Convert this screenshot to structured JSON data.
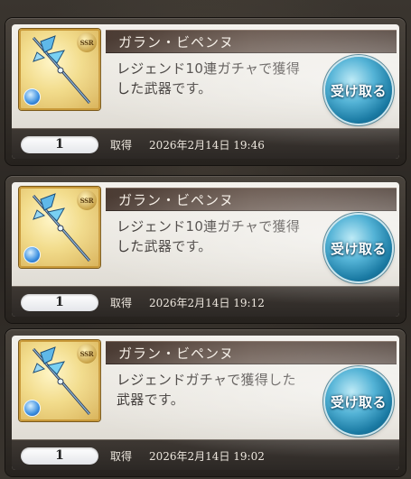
{
  "cards": [
    {
      "title": "ガラン・ビペンヌ",
      "rarity": "SSR",
      "description": "レジェンド10連ガチャで獲得した武器です。",
      "button_label": "受け取る",
      "count": "1",
      "acquired_label": "取得",
      "acquired_date": "2026年2月14日 19:46"
    },
    {
      "title": "ガラン・ビペンヌ",
      "rarity": "SSR",
      "description": "レジェンド10連ガチャで獲得した武器です。",
      "button_label": "受け取る",
      "count": "1",
      "acquired_label": "取得",
      "acquired_date": "2026年2月14日 19:12"
    },
    {
      "title": "ガラン・ビペンヌ",
      "rarity": "SSR",
      "description": "レジェンドガチャで獲得した武器です。",
      "button_label": "受け取る",
      "count": "1",
      "acquired_label": "取得",
      "acquired_date": "2026年2月14日 19:02"
    }
  ],
  "colors": {
    "title_bar": "#4b3c34",
    "button_blue": "#1a7aa3",
    "thumb_gold": "#c99a3a",
    "element_water": "#3b8fe0"
  },
  "icons": [
    "weapon-axe-icon",
    "water-element-icon",
    "ssr-rarity-icon"
  ]
}
